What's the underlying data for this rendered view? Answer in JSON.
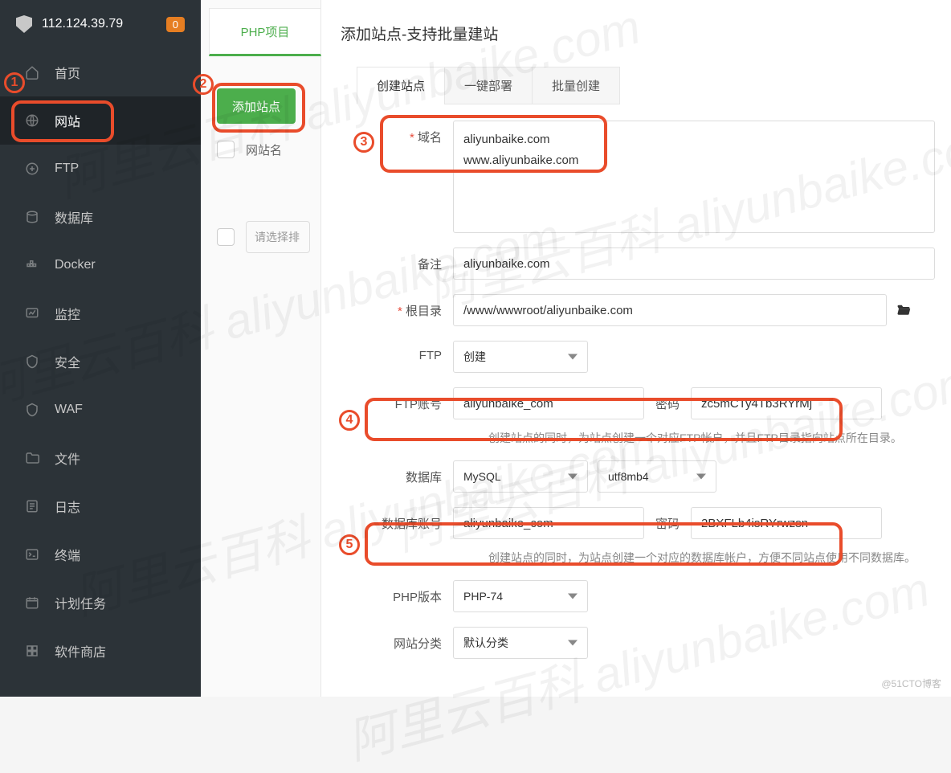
{
  "header": {
    "ip": "112.124.39.79",
    "badge": "0"
  },
  "sidebar": {
    "items": [
      {
        "label": "首页",
        "icon": "home-icon"
      },
      {
        "label": "网站",
        "icon": "globe-icon",
        "active": true
      },
      {
        "label": "FTP",
        "icon": "ftp-icon"
      },
      {
        "label": "数据库",
        "icon": "database-icon"
      },
      {
        "label": "Docker",
        "icon": "docker-icon"
      },
      {
        "label": "监控",
        "icon": "monitor-icon"
      },
      {
        "label": "安全",
        "icon": "security-icon"
      },
      {
        "label": "WAF",
        "icon": "waf-icon"
      },
      {
        "label": "文件",
        "icon": "file-icon"
      },
      {
        "label": "日志",
        "icon": "log-icon"
      },
      {
        "label": "终端",
        "icon": "terminal-icon"
      },
      {
        "label": "计划任务",
        "icon": "cron-icon"
      },
      {
        "label": "软件商店",
        "icon": "store-icon"
      }
    ]
  },
  "middle": {
    "php_tab": "PHP项目",
    "add_button": "添加站点",
    "col_sitename": "网站名",
    "filter_placeholder": "请选择排"
  },
  "modal": {
    "title": "添加站点-支持批量建站",
    "tabs": [
      "创建站点",
      "一键部署",
      "批量创建"
    ],
    "labels": {
      "domain": "域名",
      "note": "备注",
      "root": "根目录",
      "ftp": "FTP",
      "ftp_account": "FTP账号",
      "password": "密码",
      "database": "数据库",
      "db_account": "数据库账号",
      "php_version": "PHP版本",
      "site_category": "网站分类"
    },
    "values": {
      "domain_text": "aliyunbaike.com\nwww.aliyunbaike.com",
      "note": "aliyunbaike.com",
      "root": "/www/wwwroot/aliyunbaike.com",
      "ftp_select": "创建",
      "ftp_account": "aliyunbaike_com",
      "ftp_password": "zc5mCTy4Tb3RYrMj",
      "db_engine": "MySQL",
      "db_charset": "utf8mb4",
      "db_account": "aliyunbaike_com",
      "db_password": "2BXFLb4isRYrwzsn",
      "php_version": "PHP-74",
      "site_category": "默认分类"
    },
    "hints": {
      "ftp": "创建站点的同时，为站点创建一个对应FTP帐户，并且FTP目录指向站点所在目录。",
      "db": "创建站点的同时，为站点创建一个对应的数据库帐户，方便不同站点使用不同数据库。"
    }
  },
  "annotations": {
    "n1": "1",
    "n2": "2",
    "n3": "3",
    "n4": "4",
    "n5": "5"
  },
  "watermark": "阿里云百科 aliyunbaike.com",
  "credit": "@51CTO博客"
}
